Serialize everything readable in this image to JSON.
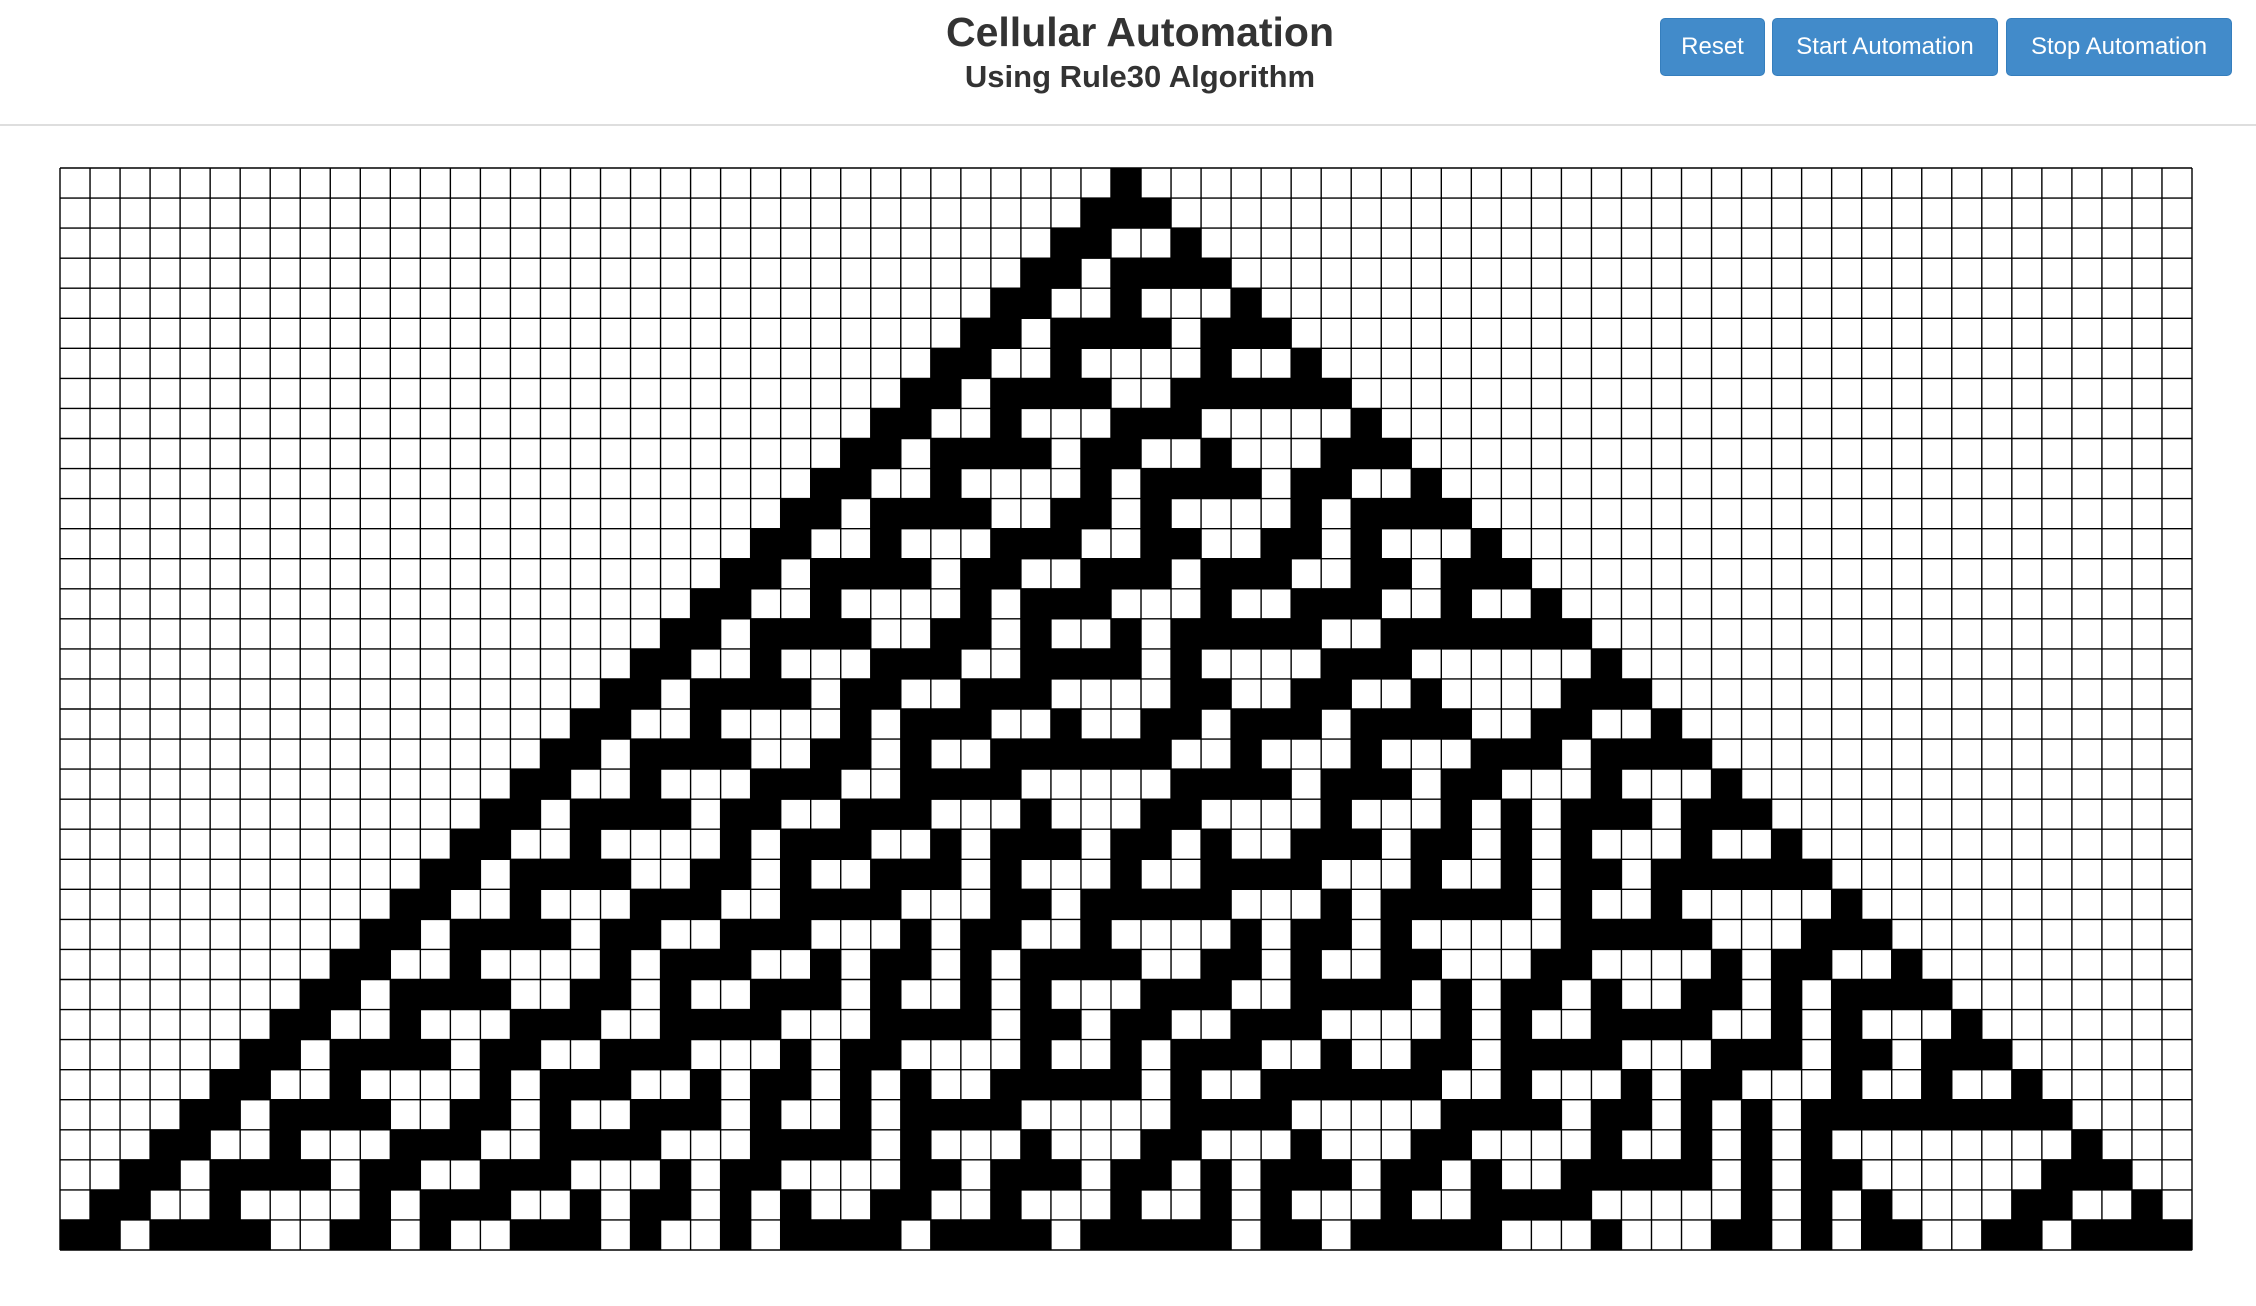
{
  "header": {
    "title": "Cellular Automation",
    "subtitle": "Using Rule30 Algorithm"
  },
  "toolbar": {
    "reset_label": "Reset",
    "start_label": "Start Automation",
    "stop_label": "Stop Automation"
  },
  "automaton": {
    "rule": 30,
    "columns": 71,
    "rows": 36,
    "generation_shown": 35,
    "initial_live_column": 35
  },
  "colors": {
    "alive": "#000000",
    "dead": "#ffffff",
    "grid_line": "#000000",
    "button": "#428bca",
    "button_border": "#357ebd",
    "title_text": "#333333"
  }
}
